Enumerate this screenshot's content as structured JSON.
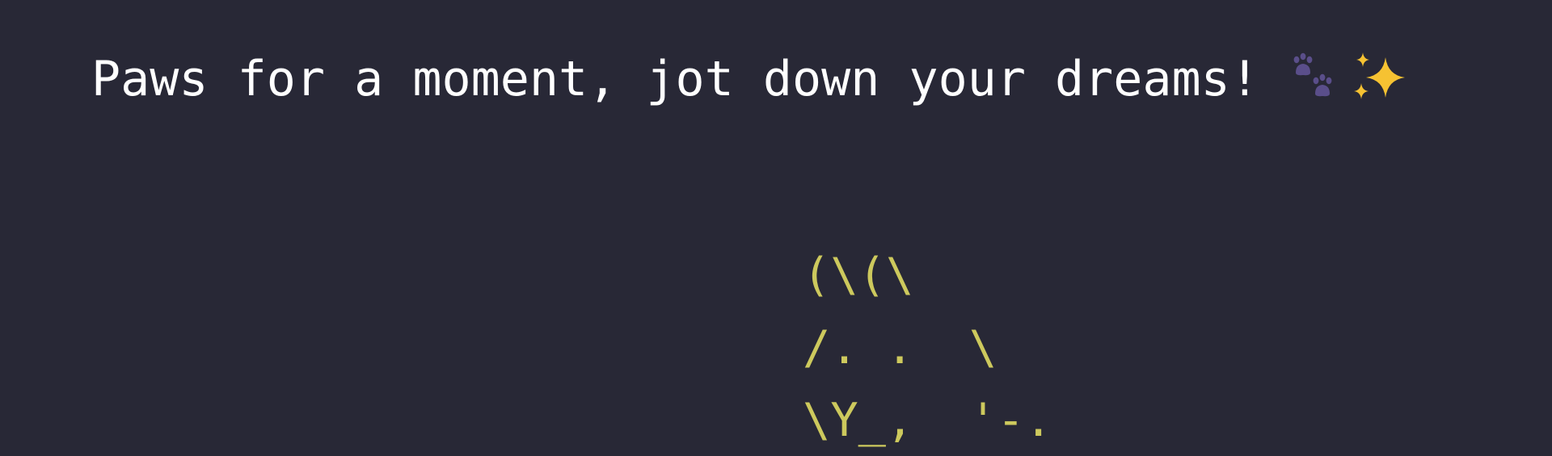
{
  "heading": {
    "text": "Paws for a moment, jot down your dreams!"
  },
  "icons": {
    "paw": "paw-prints-icon",
    "sparkles": "sparkles-icon"
  },
  "ascii_art": {
    "lines": [
      "(\\(\\",
      "/. .  \\",
      "\\Y_,  '-."
    ]
  },
  "colors": {
    "background": "#282836",
    "heading": "#ffffff",
    "ascii_art": "#cdc95d",
    "paw": "#5a4e8a",
    "sparkles": "#f6c232"
  }
}
